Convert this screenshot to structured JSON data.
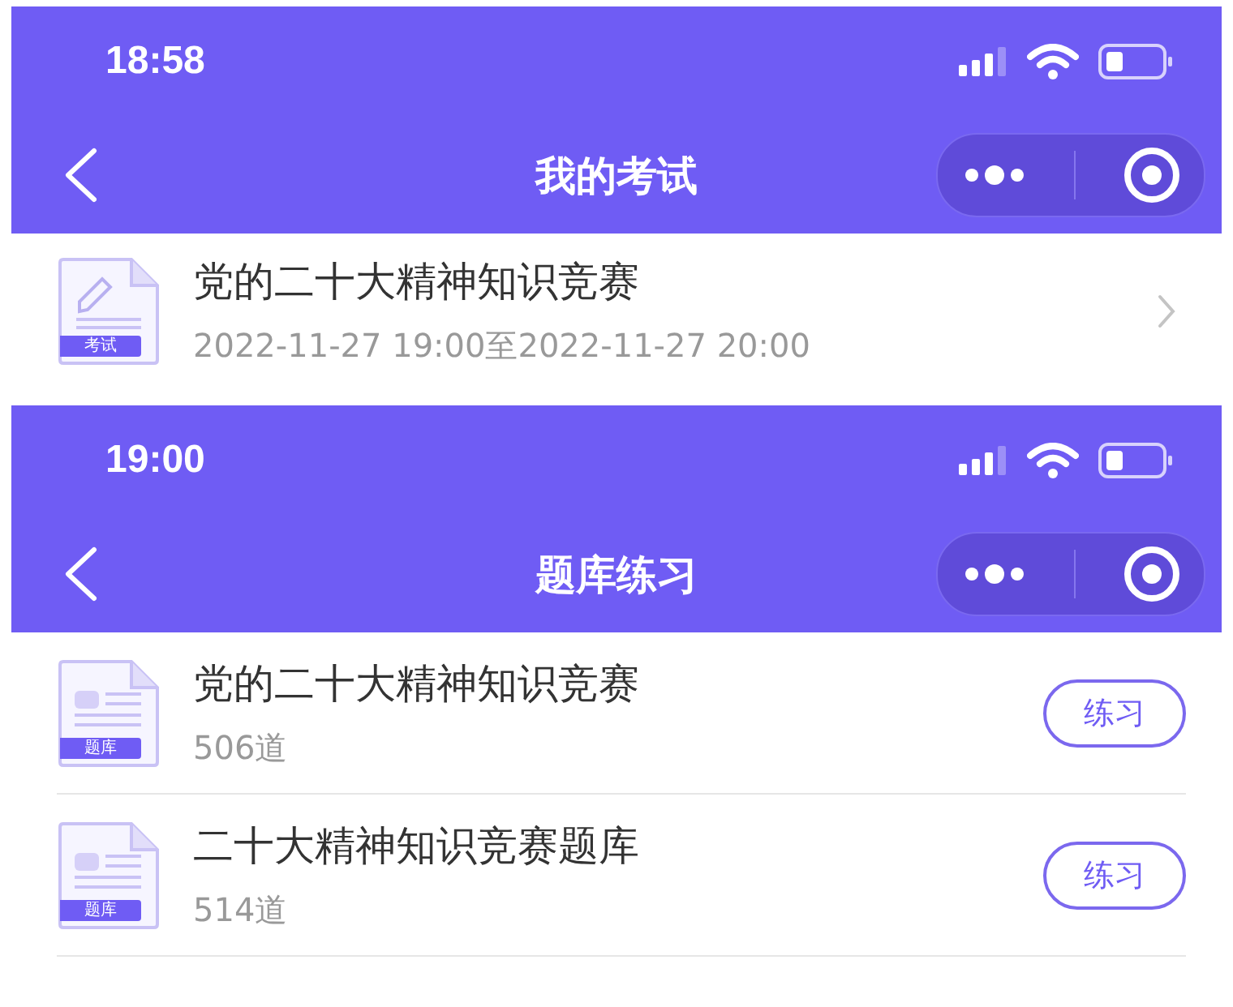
{
  "screens": [
    {
      "status_bar": {
        "time": "18:58"
      },
      "nav": {
        "title": "我的考试"
      },
      "list": {
        "kind": "exam",
        "items": [
          {
            "icon_label": "考试",
            "title": "党的二十大精神知识竞赛",
            "subtitle": "2022-11-27 19:00至2022-11-27 20:00"
          }
        ]
      }
    },
    {
      "status_bar": {
        "time": "19:00"
      },
      "nav": {
        "title": "题库练习"
      },
      "list": {
        "kind": "bank",
        "items": [
          {
            "icon_label": "题库",
            "title": "党的二十大精神知识竞赛",
            "subtitle": "506道",
            "button": "练习"
          },
          {
            "icon_label": "题库",
            "title": "二十大精神知识竞赛题库",
            "subtitle": "514道",
            "button": "练习"
          }
        ]
      }
    }
  ]
}
